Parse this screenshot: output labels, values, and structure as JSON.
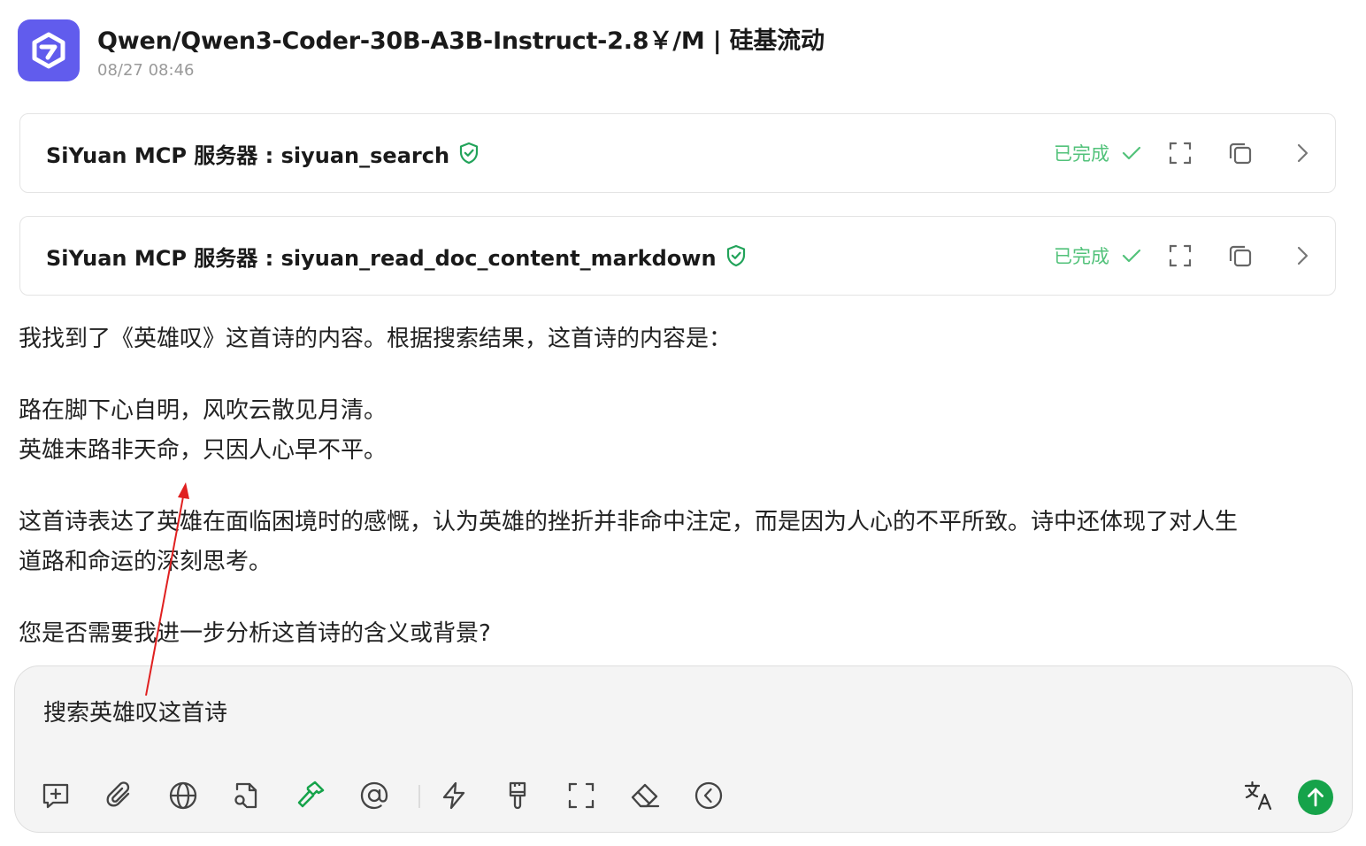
{
  "header": {
    "model_title": "Qwen/Qwen3-Coder-30B-A3B-Instruct-2.8￥/M | 硅基流动",
    "timestamp": "08/27 08:46",
    "avatar_icon": "qwen-logo-icon"
  },
  "tool_calls": [
    {
      "name": "SiYuan MCP 服务器 : siyuan_search",
      "status": "已完成"
    },
    {
      "name": "SiYuan MCP 服务器 : siyuan_read_doc_content_markdown",
      "status": "已完成"
    }
  ],
  "message": {
    "intro": "我找到了《英雄叹》这首诗的内容。根据搜索结果，这首诗的内容是：",
    "poem_line_1": "路在脚下心自明，风吹云散见月清。",
    "poem_line_2": "英雄末路非天命，只因人心早不平。",
    "analysis_line_1": "这首诗表达了英雄在面临困境时的感慨，认为英雄的挫折并非命中注定，而是因为人心的不平所致。诗中还体现了对人生",
    "analysis_line_2": "道路和命运的深刻思考。",
    "question": "您是否需要我进一步分析这首诗的含义或背景?"
  },
  "input": {
    "value": "搜索英雄叹这首诗"
  },
  "colors": {
    "accent_green": "#16a34a",
    "status_green": "#52c27a",
    "avatar_purple": "#615ced",
    "annotation_red": "#e02020"
  }
}
